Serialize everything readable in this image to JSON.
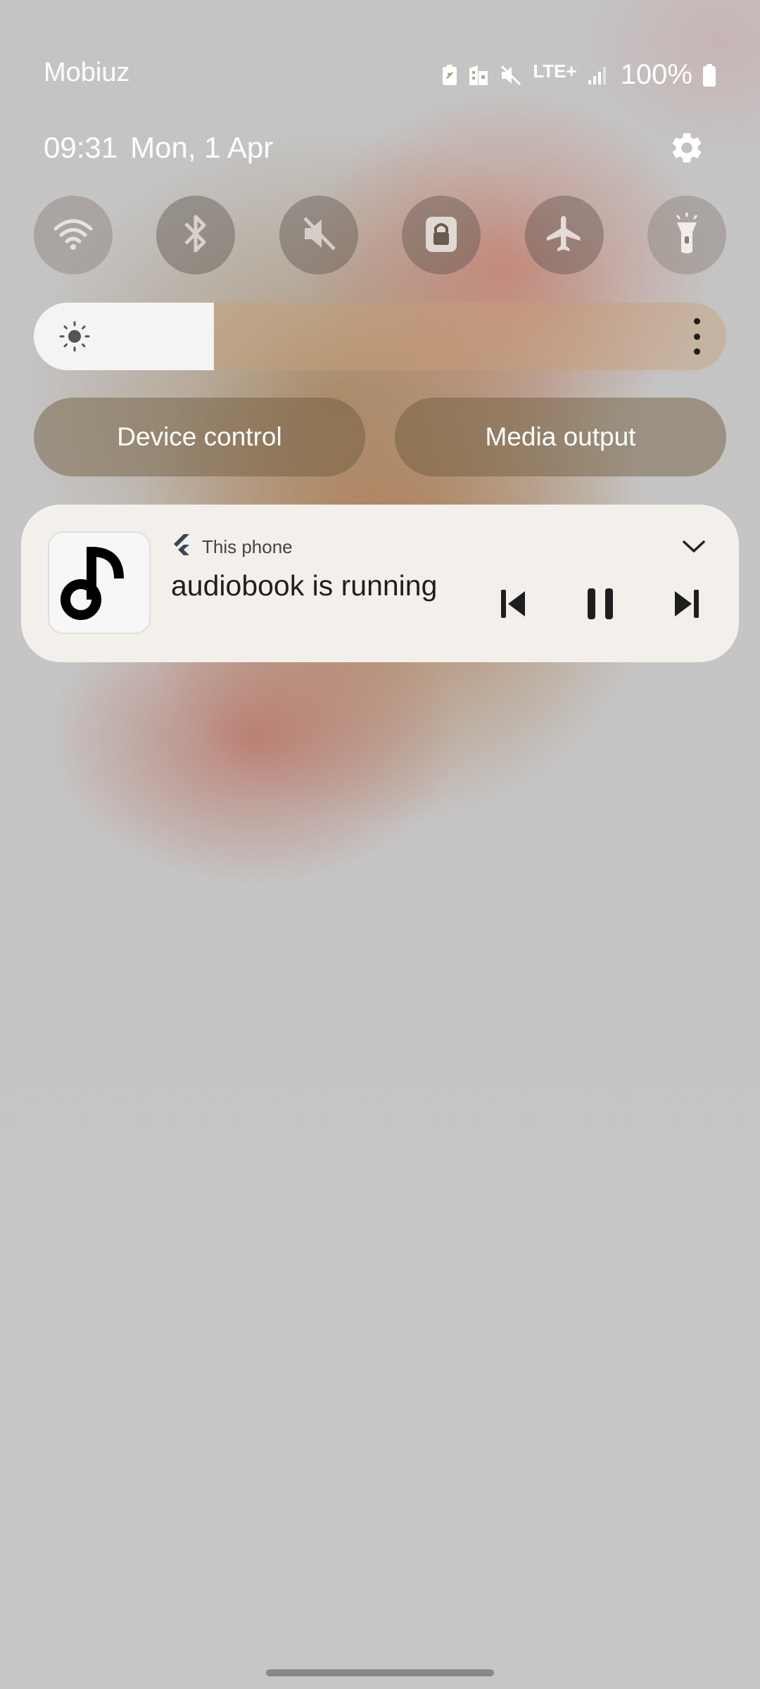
{
  "status_bar": {
    "carrier": "Mobiuz",
    "network_type": "LTE+",
    "battery_percent": "100%",
    "icons": [
      "battery-saver-icon",
      "work-profile-icon",
      "mute-icon",
      "lte-icon",
      "signal-icon",
      "battery-icon"
    ]
  },
  "header": {
    "time": "09:31",
    "date": "Mon, 1 Apr",
    "settings_icon": "gear-icon"
  },
  "quick_toggles": [
    {
      "name": "wifi",
      "icon": "wifi-icon"
    },
    {
      "name": "bluetooth",
      "icon": "bluetooth-icon"
    },
    {
      "name": "sound",
      "icon": "mute-icon"
    },
    {
      "name": "secure-folder",
      "icon": "lock-icon"
    },
    {
      "name": "airplane-mode",
      "icon": "airplane-icon"
    },
    {
      "name": "flashlight",
      "icon": "flashlight-icon"
    }
  ],
  "brightness": {
    "level": 0.26,
    "icon": "sun-icon"
  },
  "buttons": {
    "device_control": "Device control",
    "media_output": "Media output"
  },
  "media_player": {
    "source": "This phone",
    "title": "audiobook is running",
    "app_icon": "music-note-icon",
    "controls": [
      "previous-icon",
      "pause-icon",
      "next-icon"
    ]
  },
  "colors": {
    "card_background": "#f3f0ec",
    "text_dark": "#1f1f1f"
  }
}
